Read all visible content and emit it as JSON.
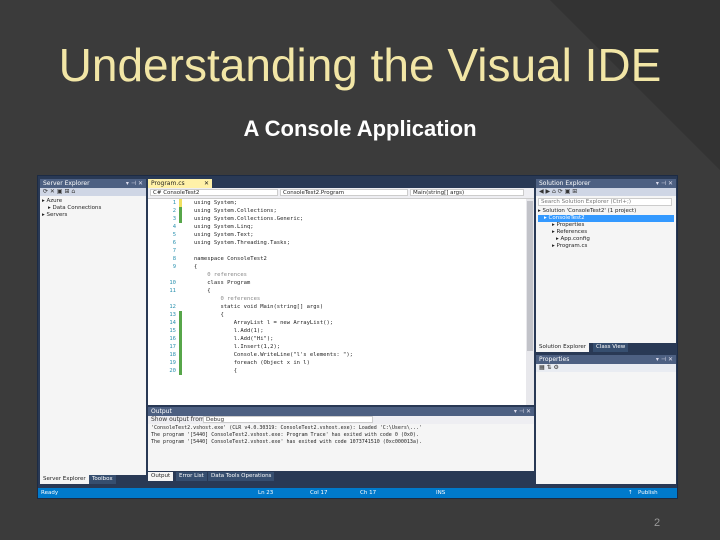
{
  "slide": {
    "title": "Understanding the Visual IDE",
    "subtitle": "A Console Application",
    "page_number": "2"
  },
  "server_explorer": {
    "title": "Server Explorer",
    "items": [
      {
        "label": "Azure"
      },
      {
        "label": "Data Connections"
      },
      {
        "label": "Servers"
      }
    ],
    "tabs": [
      "Server Explorer",
      "Toolbox"
    ]
  },
  "editor": {
    "tab": "Program.cs",
    "project_dropdown": "C# ConsoleTest2",
    "class_dropdown": "ConsoleTest2.Program",
    "member_dropdown": "Main(string[] args)",
    "lines": [
      {
        "n": "1",
        "text": "using System;",
        "bar": "yellow"
      },
      {
        "n": "2",
        "text": "using System.Collections;",
        "bar": "green"
      },
      {
        "n": "3",
        "text": "using System.Collections.Generic;",
        "bar": "green"
      },
      {
        "n": "4",
        "text": "using System.Linq;",
        "bar": "none"
      },
      {
        "n": "5",
        "text": "using System.Text;",
        "bar": "none"
      },
      {
        "n": "6",
        "text": "using System.Threading.Tasks;",
        "bar": "none"
      },
      {
        "n": "7",
        "text": "",
        "bar": "none"
      },
      {
        "n": "8",
        "text": "namespace ConsoleTest2",
        "bar": "none"
      },
      {
        "n": "9",
        "text": "{",
        "bar": "none"
      },
      {
        "n": "",
        "text": "    0 references",
        "bar": "none"
      },
      {
        "n": "10",
        "text": "    class Program",
        "bar": "none"
      },
      {
        "n": "11",
        "text": "    {",
        "bar": "none"
      },
      {
        "n": "",
        "text": "        0 references",
        "bar": "none"
      },
      {
        "n": "12",
        "text": "        static void Main(string[] args)",
        "bar": "none"
      },
      {
        "n": "13",
        "text": "        {",
        "bar": "green"
      },
      {
        "n": "14",
        "text": "            ArrayList l = new ArrayList();",
        "bar": "green"
      },
      {
        "n": "15",
        "text": "            l.Add(1);",
        "bar": "green"
      },
      {
        "n": "16",
        "text": "            l.Add(\"Hi\");",
        "bar": "green"
      },
      {
        "n": "17",
        "text": "            l.Insert(1,2);",
        "bar": "green"
      },
      {
        "n": "18",
        "text": "            Console.WriteLine(\"l's elements: \");",
        "bar": "green"
      },
      {
        "n": "19",
        "text": "            foreach (Object x in l)",
        "bar": "green"
      },
      {
        "n": "20",
        "text": "            {",
        "bar": "green"
      }
    ]
  },
  "solution_explorer": {
    "title": "Solution Explorer",
    "search_placeholder": "Search Solution Explorer (Ctrl+;)",
    "items": [
      {
        "label": "Solution 'ConsoleTest2' (1 project)"
      },
      {
        "label": "ConsoleTest2"
      },
      {
        "label": "Properties"
      },
      {
        "label": "References"
      },
      {
        "label": "App.config"
      },
      {
        "label": "Program.cs"
      }
    ],
    "tabs": [
      "Solution Explorer",
      "Class View"
    ]
  },
  "properties": {
    "title": "Properties"
  },
  "output": {
    "title": "Output",
    "show_output_label": "Show output from:",
    "source": "Debug",
    "lines": [
      "'ConsoleTest2.vshost.exe' (CLR v4.0.30319: ConsoleTest2.vshost.exe): Loaded 'C:\\Users\\...'",
      "The program '[5440] ConsoleTest2.vshost.exe: Program Trace' has exited with code 0 (0x0).",
      "The program '[5440] ConsoleTest2.vshost.exe' has exited with code 1073741510 (0xc000013a)."
    ],
    "tabs": [
      "Output",
      "Error List",
      "Data Tools Operations"
    ]
  },
  "status_bar": {
    "state": "Ready",
    "ln": "Ln 23",
    "col": "Col 17",
    "ch": "Ch 17",
    "mode": "INS",
    "publish": "Publish"
  },
  "colors": {
    "ide_frame": "#293955",
    "status_bar": "#007acc",
    "title_text": "#f2e6a6"
  }
}
